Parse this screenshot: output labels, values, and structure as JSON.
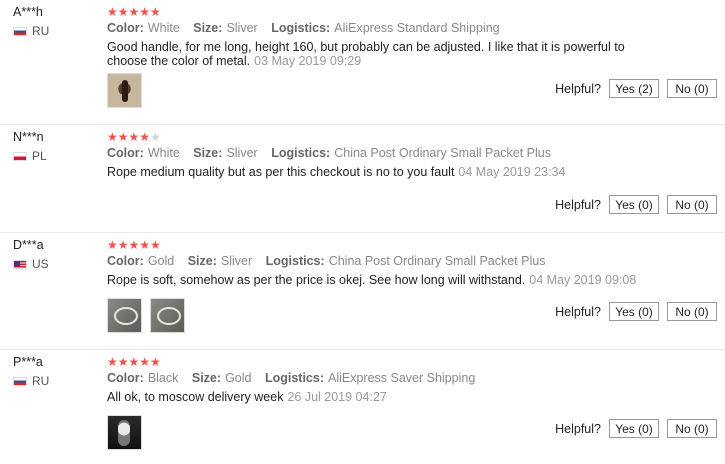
{
  "reviews": [
    {
      "user": "A***h",
      "country": "RU",
      "stars": {
        "filled": "★★★★★",
        "empty": ""
      },
      "color_label": "Color:",
      "color_value": "White",
      "size_label": "Size:",
      "size_value": "Sliver",
      "logistics_label": "Logistics:",
      "logistics_value": "AliExpress Standard Shipping",
      "text": "Good handle, for me long, height 160, but probably can be adjusted. I like that it is powerful to choose the color of metal.",
      "date": "03 May 2019 09:29",
      "helpful_label": "Helpful?",
      "yes_label": "Yes (2)",
      "no_label": "No (0)"
    },
    {
      "user": "N***n",
      "country": "PL",
      "stars": {
        "filled": "★★★★",
        "empty": "★"
      },
      "color_label": "Color:",
      "color_value": "White",
      "size_label": "Size:",
      "size_value": "Sliver",
      "logistics_label": "Logistics:",
      "logistics_value": "China Post Ordinary Small Packet Plus",
      "text": "Rope medium quality but as per this checkout is no to you fault",
      "date": "04 May 2019 23:34",
      "helpful_label": "Helpful?",
      "yes_label": "Yes (0)",
      "no_label": "No (0)"
    },
    {
      "user": "D***a",
      "country": "US",
      "stars": {
        "filled": "★★★★★",
        "empty": ""
      },
      "color_label": "Color:",
      "color_value": "Gold",
      "size_label": "Size:",
      "size_value": "Sliver",
      "logistics_label": "Logistics:",
      "logistics_value": "China Post Ordinary Small Packet Plus",
      "text": "Rope is soft, somehow as per the price is okej. See how long will withstand.",
      "date": "04 May 2019 09:08",
      "helpful_label": "Helpful?",
      "yes_label": "Yes (0)",
      "no_label": "No (0)"
    },
    {
      "user": "P***a",
      "country": "RU",
      "stars": {
        "filled": "★★★★★",
        "empty": ""
      },
      "color_label": "Color:",
      "color_value": "Black",
      "size_label": "Size:",
      "size_value": "Gold",
      "logistics_label": "Logistics:",
      "logistics_value": "AliExpress Saver Shipping",
      "text": "All ok, to moscow delivery week",
      "date": "26 Jul 2019 04:27",
      "helpful_label": "Helpful?",
      "yes_label": "Yes (0)",
      "no_label": "No (0)"
    }
  ]
}
